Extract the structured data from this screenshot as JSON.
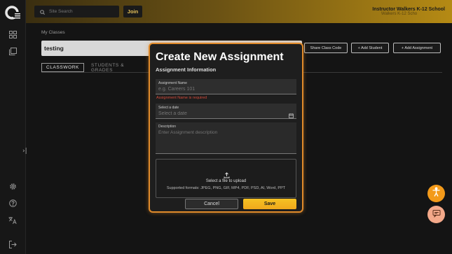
{
  "sidebar": {
    "logo": "app-logo",
    "items": [
      {
        "icon": "dashboard-icon"
      },
      {
        "icon": "library-icon"
      }
    ],
    "collapse_glyph": "›|",
    "bottom_items": [
      {
        "icon": "gear-icon"
      },
      {
        "icon": "help-icon"
      },
      {
        "icon": "translate-icon"
      },
      {
        "icon": "logout-icon"
      }
    ]
  },
  "topbar": {
    "search_placeholder": "Site Search",
    "join_label": "Join",
    "school_name": "Instructor Walkers K-12 School",
    "school_sub": "Walkers K-12 Scho"
  },
  "main": {
    "breadcrumb": "My Classes",
    "class_name": "testing",
    "share_label": "Share Class Code",
    "add_student_label": "+ Add Student",
    "add_assignment_label": "+ Add Assignment",
    "tabs": [
      {
        "label": "CLASSWORK",
        "active": true
      },
      {
        "label": "STUDENTS & GRADES",
        "active": false
      }
    ]
  },
  "modal": {
    "title": "Create New Assignment",
    "subtitle": "Assignment Information",
    "name_label": "Assignment Name",
    "name_placeholder": "e.g. Careers 101",
    "name_error": "Assignment Name is required",
    "date_label": "Select a date",
    "date_placeholder": "Select a date",
    "desc_label": "Description",
    "desc_placeholder": "Enter Assignment description",
    "upload_text": "Select a file to upload",
    "upload_formats": "Supported formats: JPEG, PNG, GIF, MP4, PDF, PSD, AI, Word, PPT",
    "cancel_label": "Cancel",
    "save_label": "Save"
  },
  "colors": {
    "accent": "#f0b420",
    "modal_border": "#e08a2a",
    "error": "#d44a3a",
    "fab_accessibility": "#f39a1a",
    "fab_chat": "#f4a98a"
  }
}
